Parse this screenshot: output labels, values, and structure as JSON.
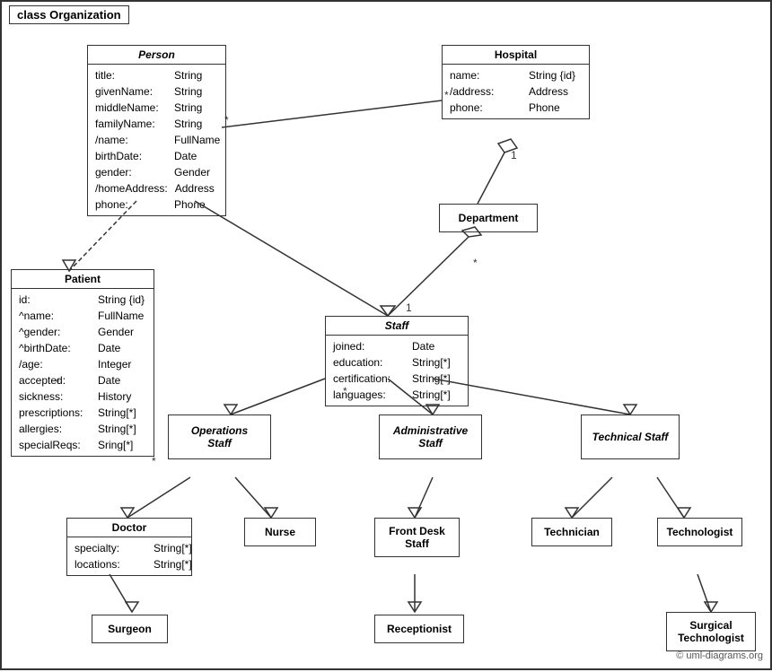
{
  "title": "class Organization",
  "classes": {
    "person": {
      "name": "Person",
      "italic": true,
      "attributes": [
        {
          "name": "title:",
          "type": "String"
        },
        {
          "name": "givenName:",
          "type": "String"
        },
        {
          "name": "middleName:",
          "type": "String"
        },
        {
          "name": "familyName:",
          "type": "String"
        },
        {
          "name": "/name:",
          "type": "FullName"
        },
        {
          "name": "birthDate:",
          "type": "Date"
        },
        {
          "name": "gender:",
          "type": "Gender"
        },
        {
          "name": "/homeAddress:",
          "type": "Address"
        },
        {
          "name": "phone:",
          "type": "Phone"
        }
      ]
    },
    "hospital": {
      "name": "Hospital",
      "italic": false,
      "attributes": [
        {
          "name": "name:",
          "type": "String {id}"
        },
        {
          "name": "/address:",
          "type": "Address"
        },
        {
          "name": "phone:",
          "type": "Phone"
        }
      ]
    },
    "patient": {
      "name": "Patient",
      "italic": false,
      "attributes": [
        {
          "name": "id:",
          "type": "String {id}"
        },
        {
          "name": "^name:",
          "type": "FullName"
        },
        {
          "name": "^gender:",
          "type": "Gender"
        },
        {
          "name": "^birthDate:",
          "type": "Date"
        },
        {
          "name": "/age:",
          "type": "Integer"
        },
        {
          "name": "accepted:",
          "type": "Date"
        },
        {
          "name": "sickness:",
          "type": "History"
        },
        {
          "name": "prescriptions:",
          "type": "String[*]"
        },
        {
          "name": "allergies:",
          "type": "String[*]"
        },
        {
          "name": "specialReqs:",
          "type": "Sring[*]"
        }
      ]
    },
    "department": {
      "name": "Department"
    },
    "staff": {
      "name": "Staff",
      "italic": true,
      "attributes": [
        {
          "name": "joined:",
          "type": "Date"
        },
        {
          "name": "education:",
          "type": "String[*]"
        },
        {
          "name": "certification:",
          "type": "String[*]"
        },
        {
          "name": "languages:",
          "type": "String[*]"
        }
      ]
    },
    "operations_staff": {
      "name": "Operations\nStaff",
      "italic": true
    },
    "administrative_staff": {
      "name": "Administrative\nStaff",
      "italic": true
    },
    "technical_staff": {
      "name": "Technical\nStaff",
      "italic": true
    },
    "doctor": {
      "name": "Doctor",
      "attributes": [
        {
          "name": "specialty:",
          "type": "String[*]"
        },
        {
          "name": "locations:",
          "type": "String[*]"
        }
      ]
    },
    "nurse": {
      "name": "Nurse"
    },
    "front_desk_staff": {
      "name": "Front Desk\nStaff"
    },
    "technician": {
      "name": "Technician"
    },
    "technologist": {
      "name": "Technologist"
    },
    "surgeon": {
      "name": "Surgeon"
    },
    "receptionist": {
      "name": "Receptionist"
    },
    "surgical_technologist": {
      "name": "Surgical\nTechnologist"
    }
  },
  "multiplicity": {
    "star": "*",
    "one": "1"
  },
  "copyright": "© uml-diagrams.org"
}
